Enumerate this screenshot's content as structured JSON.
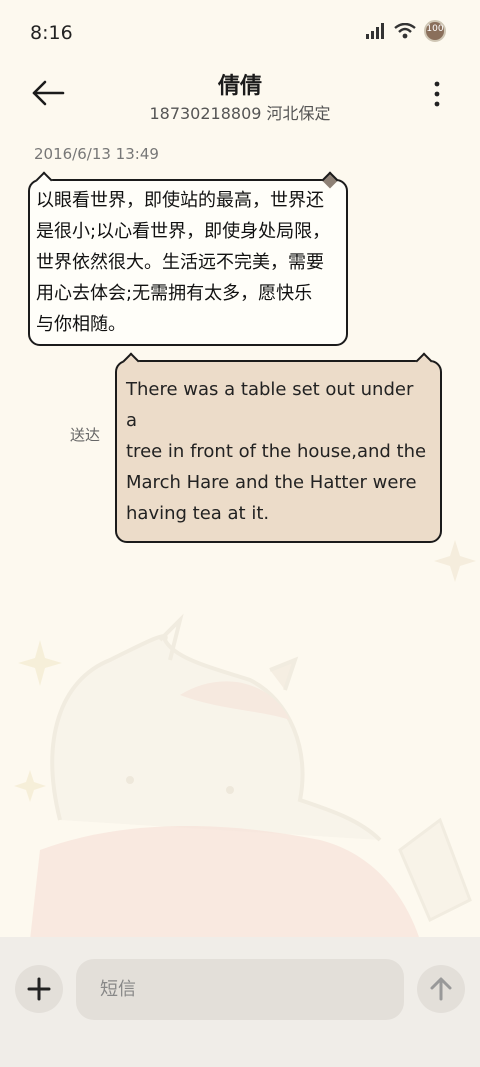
{
  "status_bar": {
    "time": "8:16",
    "battery_level": "100",
    "icons": [
      "signal-icon",
      "wifi-icon",
      "battery-icon"
    ]
  },
  "header": {
    "contact_name": "倩倩",
    "contact_detail": "18730218809 河北保定",
    "icons": [
      "back-arrow-icon",
      "more-vertical-icon"
    ]
  },
  "conversation": {
    "timestamp": "2016/6/13 13:49",
    "incoming_lines": [
      "以眼看世界，即使站的最高，世界还",
      "是很小;以心看世界，即使身处局限，",
      "世界依然很大。生活远不完美，需要",
      "用心去体会;无需拥有太多，愿快乐",
      "与你相随。"
    ],
    "outgoing_lines": [
      "There was a table set out under a",
      "tree in front of the house,and the",
      "March Hare and the Hatter were",
      "having tea at it."
    ],
    "delivery_status": "送达"
  },
  "composer": {
    "placeholder": "短信",
    "icons": [
      "plus-icon",
      "send-arrow-icon"
    ]
  },
  "colors": {
    "background": "#fdf9ef",
    "incoming_bubble": "#fffef9",
    "outgoing_bubble": "#ecdcc9",
    "composer_bar": "#f0ede8"
  }
}
